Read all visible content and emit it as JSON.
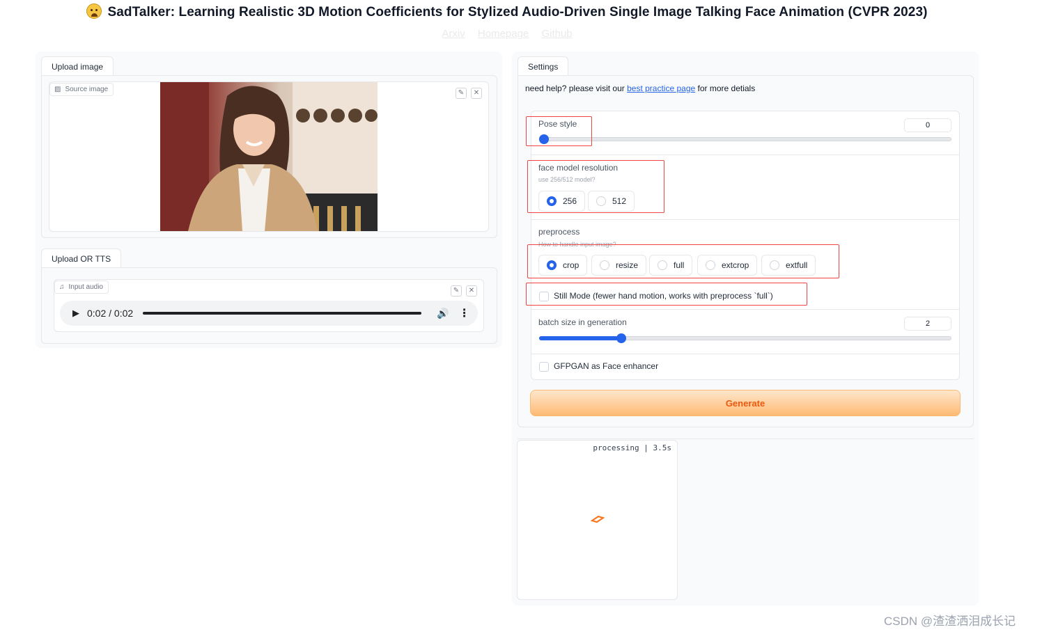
{
  "header": {
    "title": "SadTalker: Learning Realistic 3D Motion Coefficients for Stylized Audio-Driven Single Image Talking Face Animation (CVPR 2023)",
    "links": [
      "Arxiv",
      "Homepage",
      "Github"
    ]
  },
  "left": {
    "upload_image_tab": "Upload image",
    "source_image_label": "Source image",
    "upload_tts_tab": "Upload OR TTS",
    "input_audio_label": "Input audio",
    "audio_time": "0:02 / 0:02",
    "audio_progress": 1.0
  },
  "settings": {
    "tab": "Settings",
    "help_prefix": "need help? please visit our",
    "help_link": "best practice page",
    "help_suffix": "for more detials",
    "pose_style": {
      "label": "Pose style",
      "value": "0",
      "fraction": 0.0
    },
    "face_model_resolution": {
      "label": "face model resolution",
      "info": "use 256/512 model?",
      "options": [
        "256",
        "512"
      ],
      "selected": "256"
    },
    "preprocess": {
      "label": "preprocess",
      "info": "How to handle input image?",
      "options": [
        "crop",
        "resize",
        "full",
        "extcrop",
        "extfull"
      ],
      "selected": "crop"
    },
    "still_mode": {
      "label": "Still Mode (fewer hand motion, works with preprocess `full`)",
      "checked": false
    },
    "batch_size": {
      "label": "batch size in generation",
      "value": "2",
      "fraction": 0.2
    },
    "gfpgan": {
      "label": "GFPGAN as Face enhancer",
      "checked": false
    },
    "generate_button": "Generate"
  },
  "output": {
    "status": "processing | 3.5s"
  },
  "watermark": "CSDN @渣渣洒泪成长记",
  "colors": {
    "accent": "#2563eb",
    "generate_text": "#ea580c",
    "highlight_box": "#ef4444"
  }
}
